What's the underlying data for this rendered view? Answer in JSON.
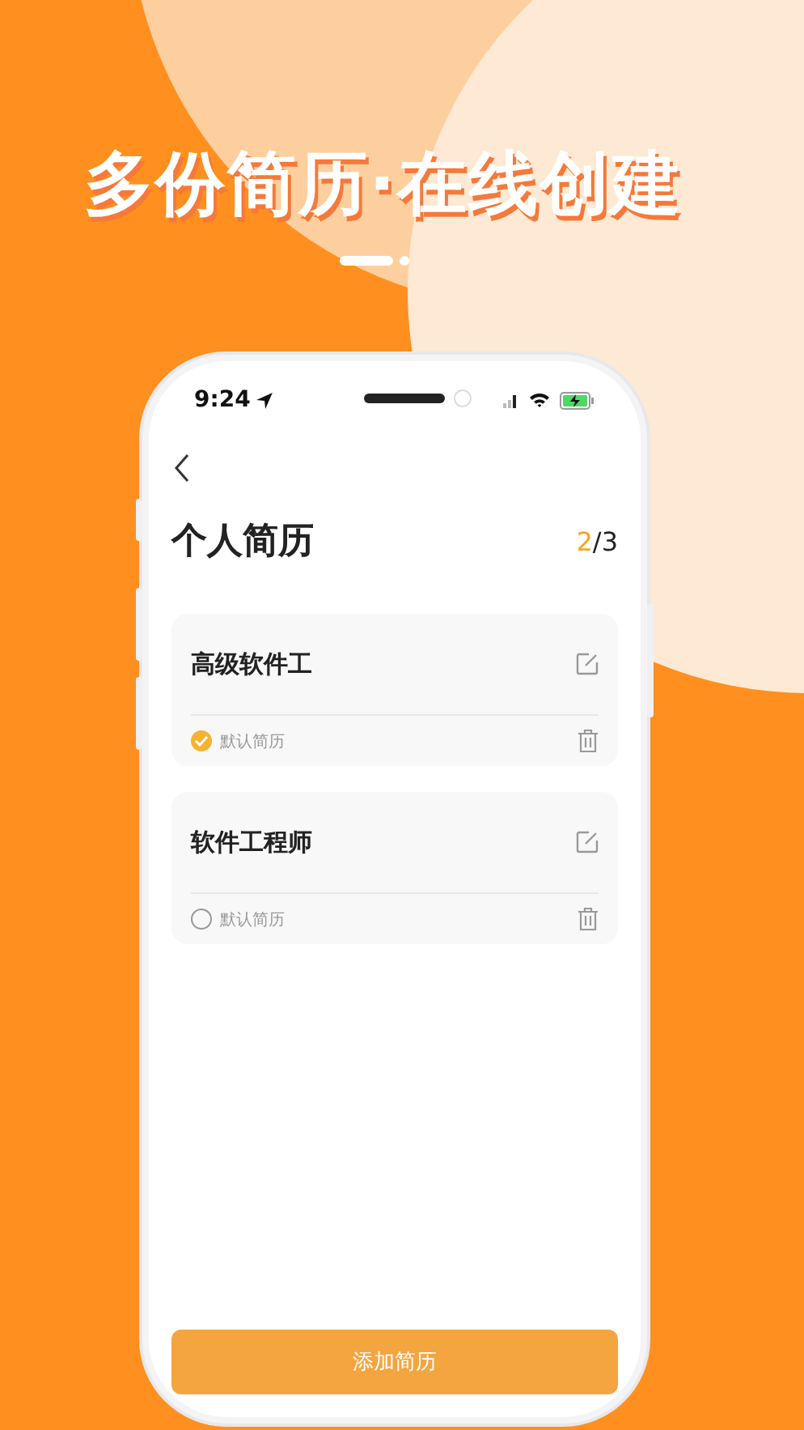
{
  "headline": "多份简历·在线创建",
  "status_bar": {
    "time": "9:24"
  },
  "page": {
    "title": "个人简历",
    "counter": {
      "current": "2",
      "rest": "/3"
    }
  },
  "resumes": [
    {
      "title": "高级软件工",
      "default_label": "默认简历",
      "selected": true
    },
    {
      "title": "软件工程师",
      "default_label": "默认简历",
      "selected": false
    }
  ],
  "add_button": "添加简历"
}
